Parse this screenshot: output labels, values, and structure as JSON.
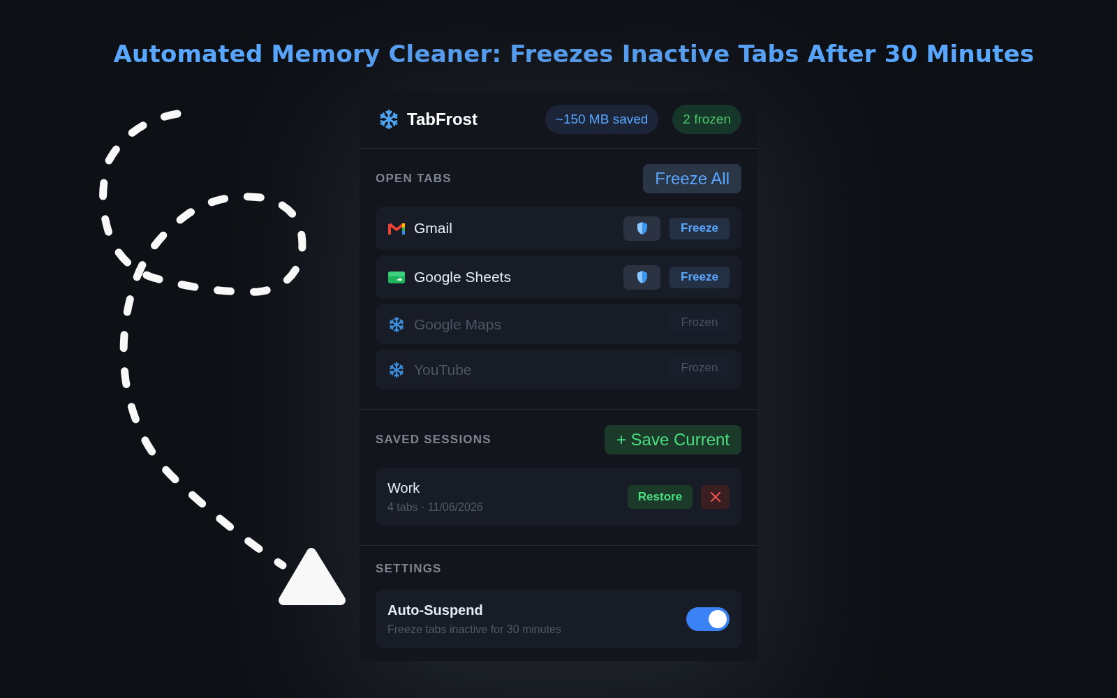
{
  "headline": "Automated Memory Cleaner: Freezes Inactive Tabs After 30 Minutes",
  "popup": {
    "header": {
      "title": "TabFrost",
      "badges": [
        {
          "kind": "saved",
          "text": "~150 MB saved"
        },
        {
          "kind": "frozen",
          "text": "2 frozen"
        }
      ]
    },
    "open_tabs": {
      "heading": "OPEN TABS",
      "button": "Freeze All",
      "items": [
        {
          "title": "Gmail",
          "frozen": false,
          "action": "Freeze"
        },
        {
          "title": "Google Sheets",
          "frozen": false,
          "action": "Freeze"
        },
        {
          "title": "Google Maps",
          "frozen": true,
          "action": "Frozen"
        },
        {
          "title": "YouTube",
          "frozen": true,
          "action": "Frozen"
        }
      ]
    },
    "saved_sessions": {
      "heading": "SAVED SESSIONS",
      "button": "+ Save Current",
      "items": [
        {
          "name": "Work",
          "details": "4 tabs · 11/06/2026",
          "restore": "Restore"
        }
      ]
    },
    "settings": {
      "heading": "SETTINGS",
      "items": [
        {
          "label": "Auto-Suspend",
          "description": "Freeze tabs inactive for 30 minutes",
          "on": true
        }
      ]
    }
  }
}
